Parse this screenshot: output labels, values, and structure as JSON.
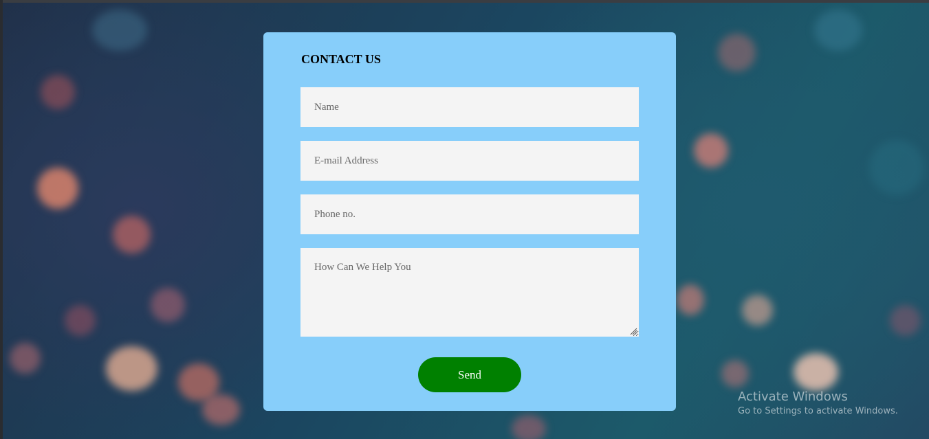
{
  "form": {
    "title": "CONTACT US",
    "name_placeholder": "Name",
    "email_placeholder": "E-mail Address",
    "phone_placeholder": "Phone no.",
    "message_placeholder": "How Can We Help You",
    "send_label": "Send"
  },
  "watermark": {
    "title": "Activate Windows",
    "subtitle": "Go to Settings to activate Windows."
  },
  "colors": {
    "card_background": "#87cefa",
    "field_background": "#f4f4f4",
    "send_button": "#008000"
  }
}
